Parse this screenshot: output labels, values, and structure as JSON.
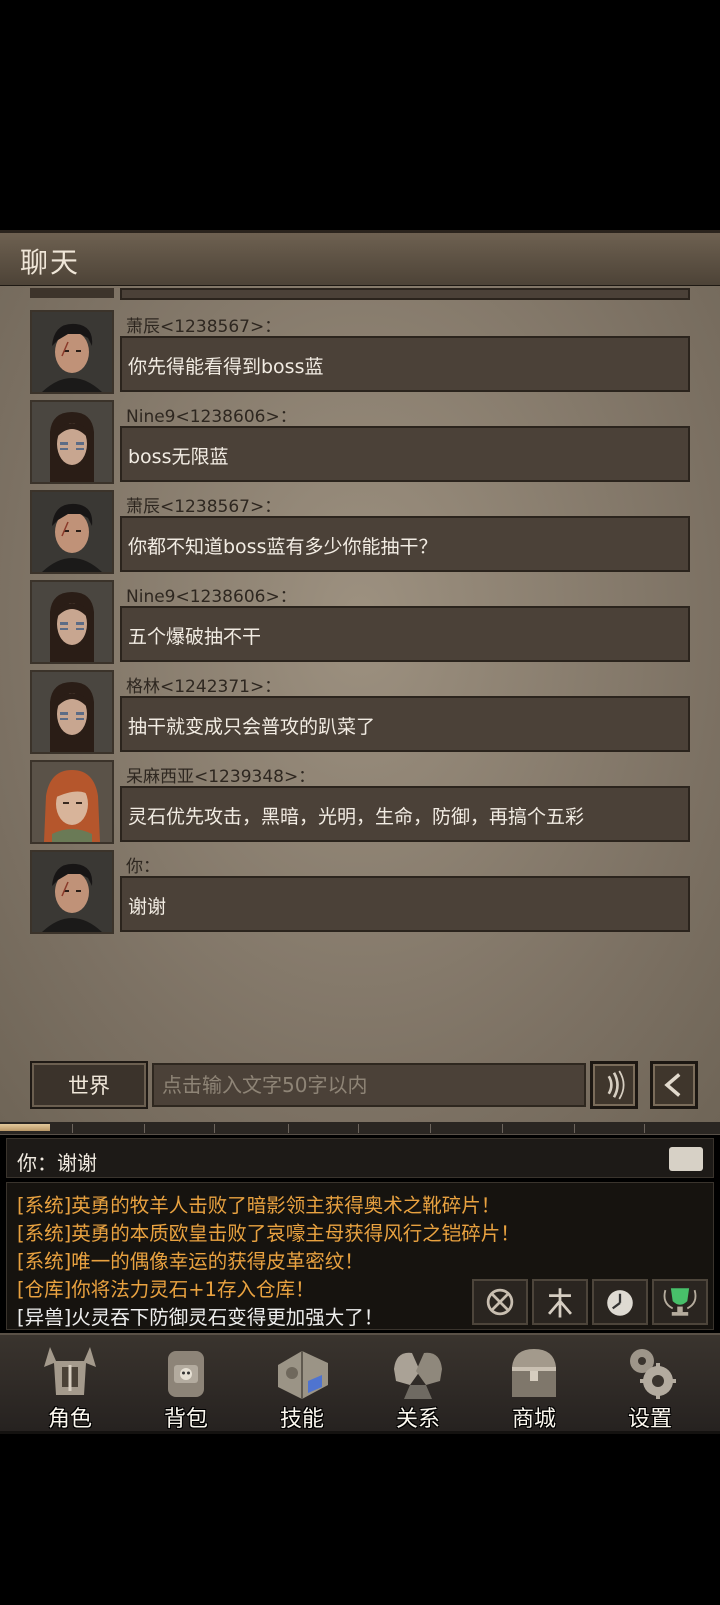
{
  "header": {
    "title": "聊天"
  },
  "messages": [
    {
      "sender": "萧辰<1238567>：",
      "text": "你先得能看得到boss蓝",
      "avatar": "avatar-male-warrior"
    },
    {
      "sender": "Nine9<1238606>：",
      "text": "boss无限蓝",
      "avatar": "avatar-female-warpaint"
    },
    {
      "sender": "萧辰<1238567>：",
      "text": "你都不知道boss蓝有多少你能抽干？",
      "avatar": "avatar-male-warrior"
    },
    {
      "sender": "Nine9<1238606>：",
      "text": "五个爆破抽不干",
      "avatar": "avatar-female-warpaint"
    },
    {
      "sender": "格林<1242371>：",
      "text": "抽干就变成只会普攻的趴菜了",
      "avatar": "avatar-female-warpaint"
    },
    {
      "sender": "呆麻西亚<1239348>：",
      "text": "灵石优先攻击，黑暗，光明，生命，防御，再搞个五彩",
      "avatar": "avatar-female-redhair"
    },
    {
      "sender": "你：",
      "text": "谢谢",
      "avatar": "avatar-male-warrior"
    }
  ],
  "input": {
    "channel": "世界",
    "placeholder": "点击输入文字50字以内"
  },
  "latest": {
    "text": "你：谢谢"
  },
  "progress": {
    "fraction": 0.07
  },
  "log": [
    {
      "text": "[系统]英勇的牧羊人击败了暗影领主获得奥术之靴碎片！",
      "color": "orange"
    },
    {
      "text": "[系统]英勇的本质欧皇击败了哀嚎主母获得风行之铠碎片！",
      "color": "orange"
    },
    {
      "text": "[系统]唯一的偶像幸运的获得皮革密纹！",
      "color": "orange"
    },
    {
      "text": "[仓库]你将法力灵石+1存入仓库！",
      "color": "orange"
    },
    {
      "text": "[异兽]火灵吞下防御灵石变得更加强大了！",
      "color": "white"
    }
  ],
  "nav": [
    {
      "label": "角色",
      "icon": "helmet-icon"
    },
    {
      "label": "背包",
      "icon": "backpack-icon"
    },
    {
      "label": "技能",
      "icon": "spellbook-icon"
    },
    {
      "label": "关系",
      "icon": "gauntlets-icon"
    },
    {
      "label": "商城",
      "icon": "treasure-chest-icon"
    },
    {
      "label": "设置",
      "icon": "gears-icon"
    }
  ],
  "tools": [
    "crosshair-gear-icon",
    "tree-rune-icon",
    "clock-icon",
    "trophy-icon"
  ],
  "colors": {
    "log_orange": "#e9a240",
    "bubble": "#4b4138",
    "panel": "#8f8474"
  }
}
